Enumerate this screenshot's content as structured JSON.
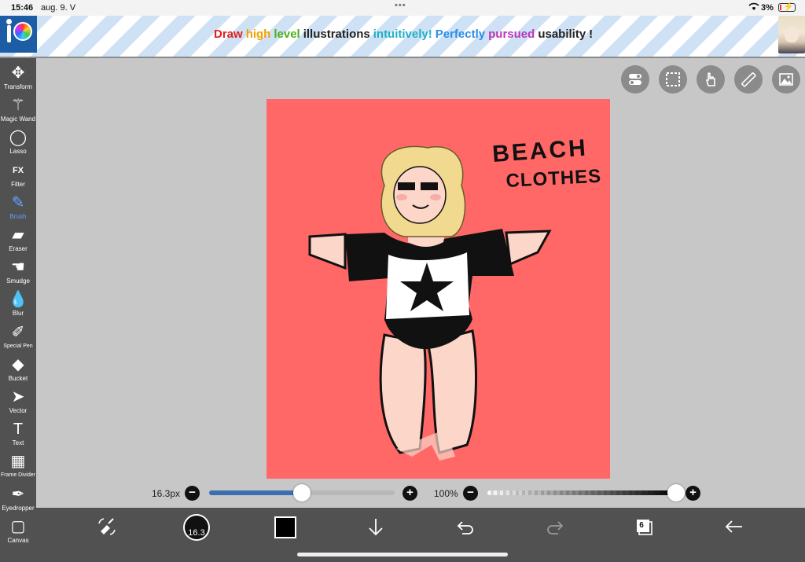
{
  "status_bar": {
    "time": "15:46",
    "date": "aug. 9. V",
    "battery": "3%"
  },
  "banner": {
    "tagline": [
      {
        "text": "Draw",
        "color": "#e02020"
      },
      {
        "text": "high",
        "color": "#f2a100"
      },
      {
        "text": "level",
        "color": "#4cb020"
      },
      {
        "text": "illustrations",
        "color": "#222222"
      },
      {
        "text": "intuitively!",
        "color": "#20b0c8"
      },
      {
        "text": "Perfectly",
        "color": "#2a8ee8"
      },
      {
        "text": "pursued",
        "color": "#b838b8"
      },
      {
        "text": "usability",
        "color": "#222222"
      },
      {
        "text": "!",
        "color": "#222222"
      }
    ]
  },
  "tools": [
    {
      "label": "Transform",
      "icon": "move-icon",
      "glyph": "✥"
    },
    {
      "label": "Magic Wand",
      "icon": "magic-wand-icon",
      "glyph": "⚚"
    },
    {
      "label": "Lasso",
      "icon": "lasso-icon",
      "glyph": "◯"
    },
    {
      "label": "Filter",
      "icon": "filter-fx-icon",
      "glyph": "FX"
    },
    {
      "label": "Brush",
      "icon": "brush-icon",
      "glyph": "✎",
      "active": true
    },
    {
      "label": "Eraser",
      "icon": "eraser-icon",
      "glyph": "▰"
    },
    {
      "label": "Smudge",
      "icon": "smudge-icon",
      "glyph": "☚"
    },
    {
      "label": "Blur",
      "icon": "blur-drop-icon",
      "glyph": "💧"
    },
    {
      "label": "Special Pen",
      "icon": "special-pen-icon",
      "glyph": "✐"
    },
    {
      "label": "Bucket",
      "icon": "bucket-icon",
      "glyph": "◆"
    },
    {
      "label": "Vector",
      "icon": "vector-cursor-icon",
      "glyph": "➤"
    },
    {
      "label": "Text",
      "icon": "text-icon",
      "glyph": "T"
    },
    {
      "label": "Frame Divider",
      "icon": "frame-divider-icon",
      "glyph": "▦"
    },
    {
      "label": "Eyedropper",
      "icon": "eyedropper-icon",
      "glyph": "✒"
    },
    {
      "label": "Canvas",
      "icon": "canvas-icon",
      "glyph": "▢"
    }
  ],
  "canvas": {
    "background": "#ff6866",
    "drawing_text_line1": "BEACH",
    "drawing_text_line2": "CLOTHES"
  },
  "brush_size": {
    "label": "16.3px",
    "value": 0.5
  },
  "opacity": {
    "label": "100%",
    "value": 1.0
  },
  "bottom_bar": {
    "brush_size_badge": "16.3",
    "layer_count": "6",
    "current_color": "#000000"
  }
}
